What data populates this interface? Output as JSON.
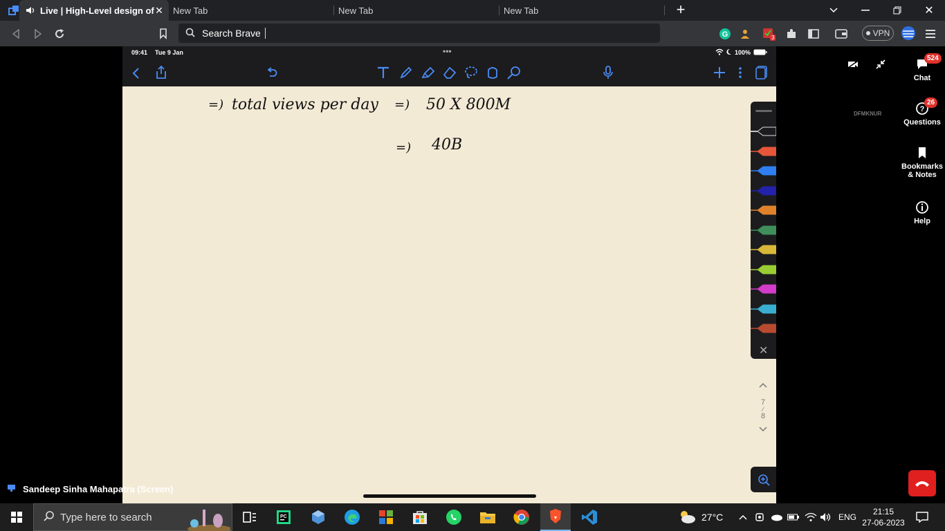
{
  "browser": {
    "tabs": [
      {
        "label": "Live | High-Level design of You",
        "active": true
      },
      {
        "label": "New Tab",
        "active": false
      },
      {
        "label": "New Tab",
        "active": false
      },
      {
        "label": "New Tab",
        "active": false
      }
    ],
    "address_placeholder": "Search Brave",
    "vpn_label": "VPN",
    "extension_badge": "3"
  },
  "meeting_sidebar": {
    "chat_label": "Chat",
    "chat_count": "524",
    "questions_label": "Questions",
    "questions_count": "26",
    "bookmarks_label_1": "Bookmarks",
    "bookmarks_label_2": "& Notes",
    "help_label": "Help",
    "watermark": "DFMKNUR"
  },
  "ipad": {
    "time": "09:41",
    "date": "Tue 9 Jan",
    "battery": "100%",
    "page_current": "7",
    "page_total": "8",
    "pen_colors": [
      "#ffffff",
      "#e8563a",
      "#2f7ff0",
      "#2222aa",
      "#e0822b",
      "#3f8f5a",
      "#d8b838",
      "#9acd32",
      "#d23cc8",
      "#3aaed0",
      "#b84a30"
    ]
  },
  "handwriting": {
    "line1_arrow": "=)",
    "line1_text": "total views per day",
    "line1_eq": "=)",
    "line1_value": "50 X 800M",
    "line2_eq": "=)",
    "line2_value": "40B"
  },
  "presenter": {
    "name": "Sandeep Sinha Mahapatra (Screen)"
  },
  "taskbar": {
    "search_placeholder": "Type here to search",
    "weather": "27°C",
    "language": "ENG",
    "time": "21:15",
    "date": "27-06-2023"
  }
}
